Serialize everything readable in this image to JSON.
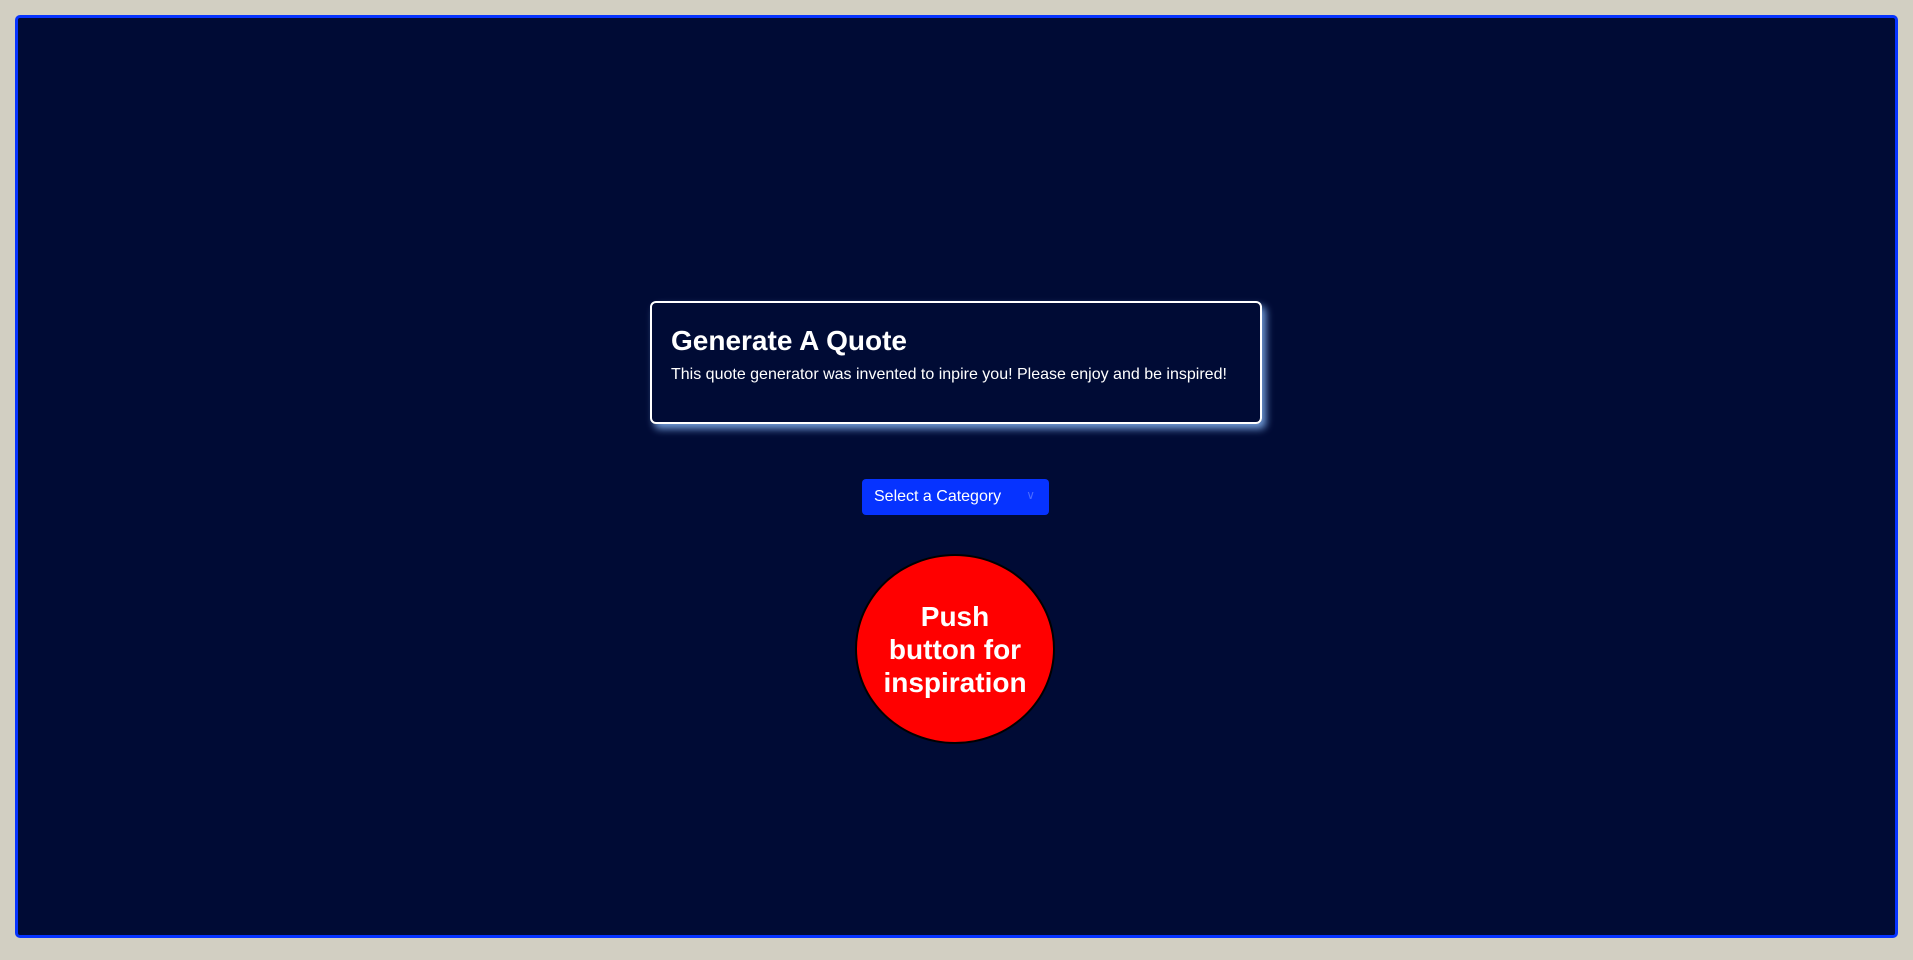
{
  "card": {
    "title": "Generate A Quote",
    "description": "This quote generator was invented to inpire you! Please enjoy and be inspired!"
  },
  "category_select": {
    "selected": "Select a Category",
    "icon": "chevron-down-icon"
  },
  "push_button": {
    "label": "Push button for inspiration",
    "color": "#ff0000"
  },
  "colors": {
    "background": "#000b35",
    "accent": "#0633ff",
    "outer": "#d2cfc2"
  }
}
